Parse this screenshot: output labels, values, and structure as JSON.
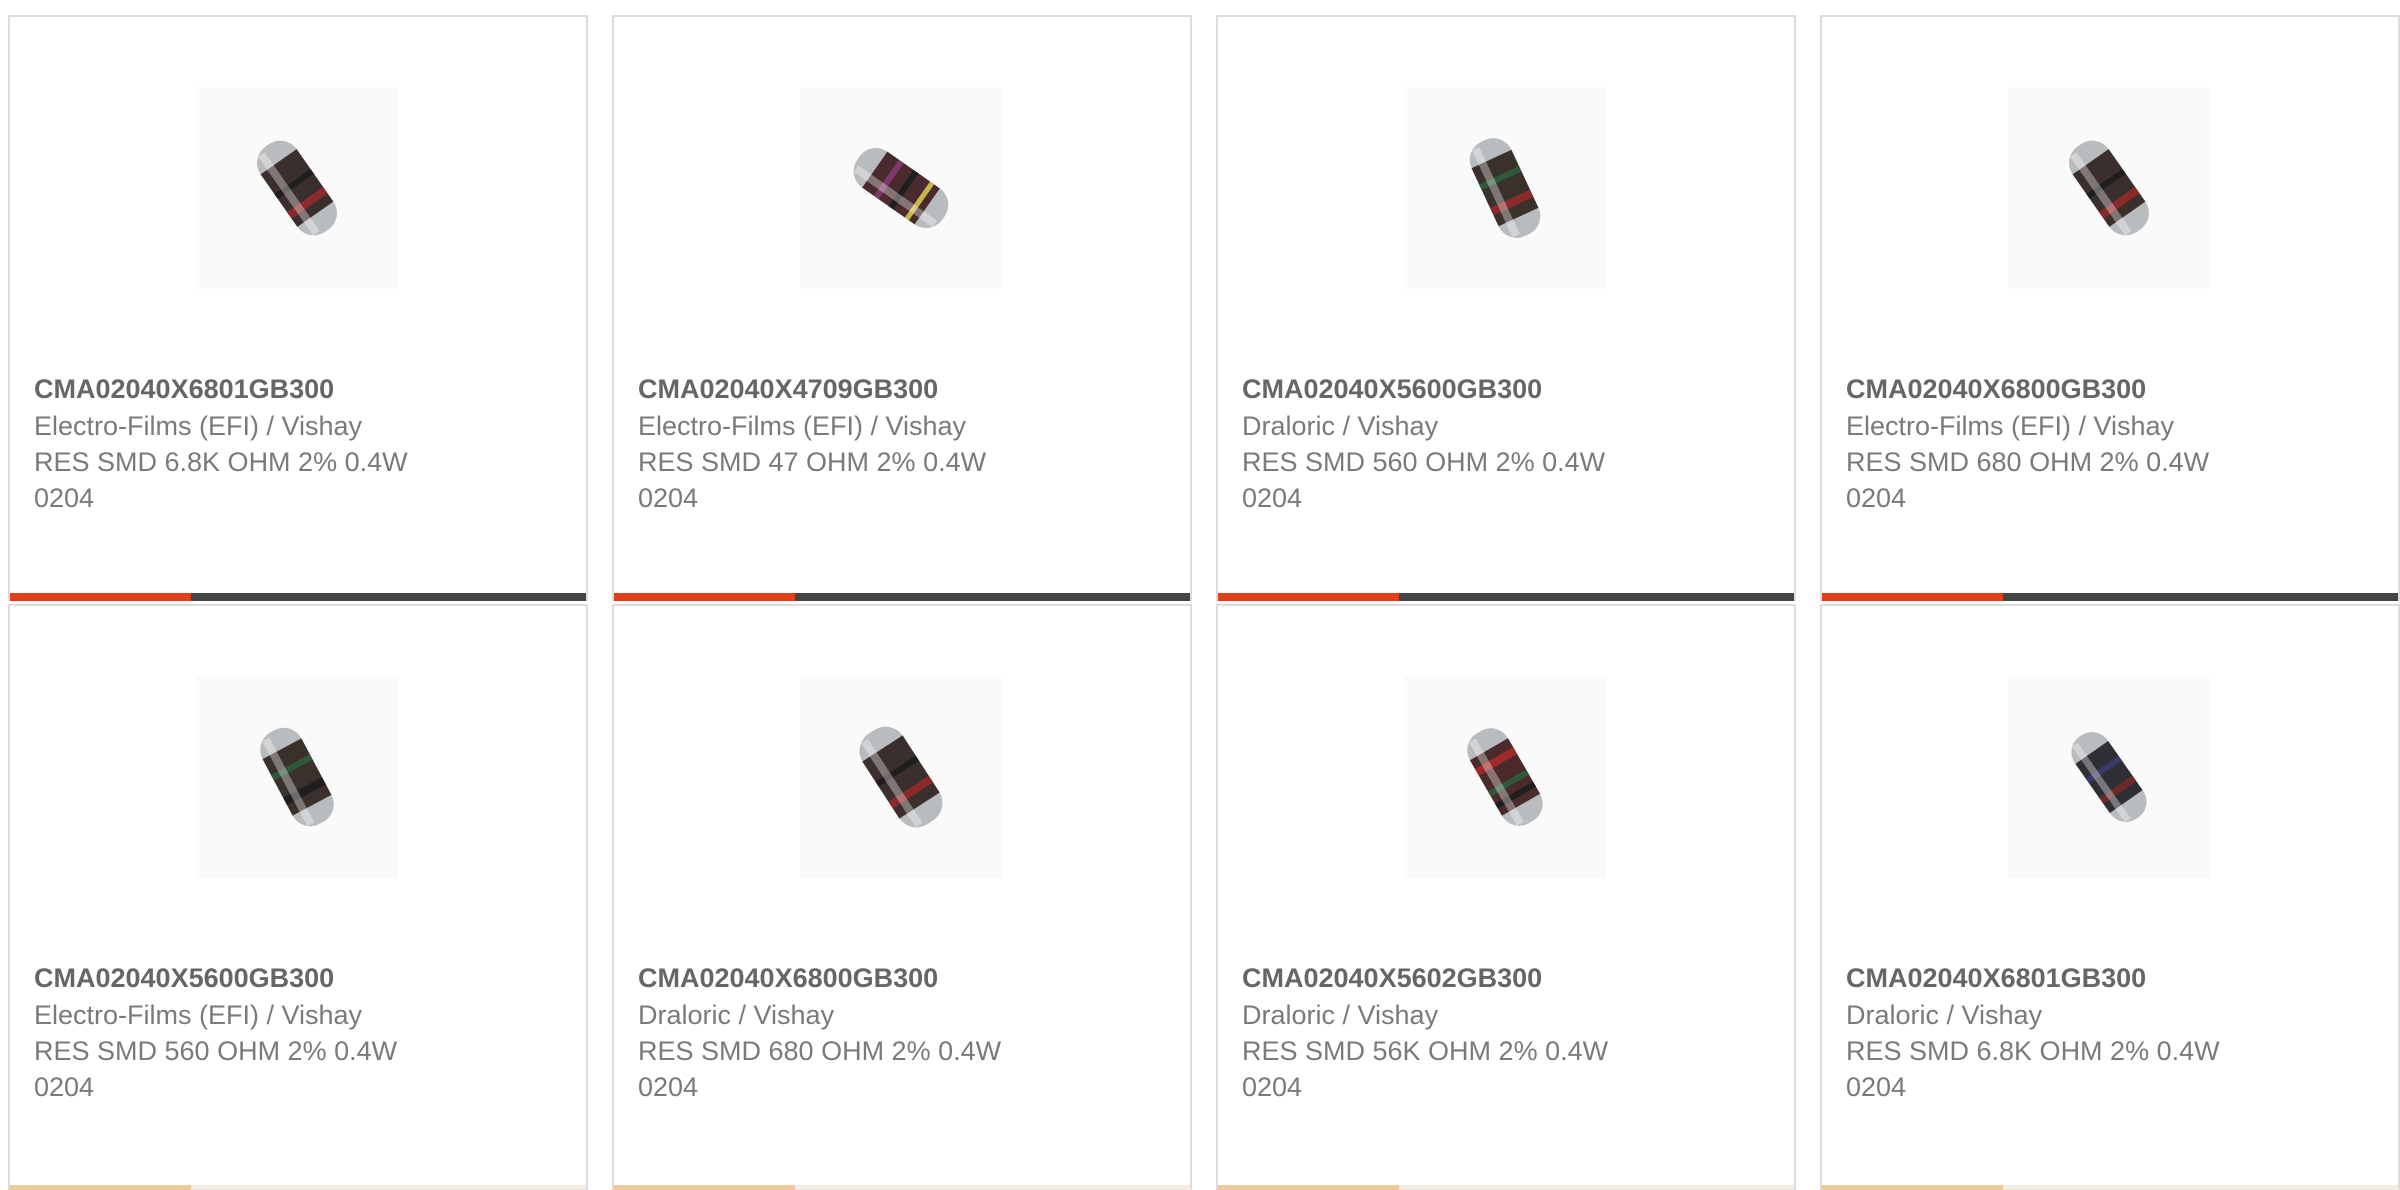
{
  "accent_color": "#e0401a",
  "bar_color": "#444444",
  "products": [
    {
      "part_number": "CMA02040X6801GB300",
      "manufacturer": "Electro-Films (EFI) / Vishay",
      "description_line1": "RES SMD 6.8K OHM 2% 0.4W",
      "description_line2": "0204",
      "image_icon": "resistor-image"
    },
    {
      "part_number": "CMA02040X4709GB300",
      "manufacturer": "Electro-Films (EFI) / Vishay",
      "description_line1": "RES SMD 47 OHM 2% 0.4W",
      "description_line2": "0204",
      "image_icon": "resistor-image"
    },
    {
      "part_number": "CMA02040X5600GB300",
      "manufacturer": "Draloric / Vishay",
      "description_line1": "RES SMD 560 OHM 2% 0.4W",
      "description_line2": "0204",
      "image_icon": "resistor-image"
    },
    {
      "part_number": "CMA02040X6800GB300",
      "manufacturer": "Electro-Films (EFI) / Vishay",
      "description_line1": "RES SMD 680 OHM 2% 0.4W",
      "description_line2": "0204",
      "image_icon": "resistor-image"
    },
    {
      "part_number": "CMA02040X5600GB300",
      "manufacturer": "Electro-Films (EFI) / Vishay",
      "description_line1": "RES SMD 560 OHM 2% 0.4W",
      "description_line2": "0204",
      "image_icon": "resistor-image"
    },
    {
      "part_number": "CMA02040X6800GB300",
      "manufacturer": "Draloric / Vishay",
      "description_line1": "RES SMD 680 OHM 2% 0.4W",
      "description_line2": "0204",
      "image_icon": "resistor-image"
    },
    {
      "part_number": "CMA02040X5602GB300",
      "manufacturer": "Draloric / Vishay",
      "description_line1": "RES SMD 56K OHM 2% 0.4W",
      "description_line2": "0204",
      "image_icon": "resistor-image"
    },
    {
      "part_number": "CMA02040X6801GB300",
      "manufacturer": "Draloric / Vishay",
      "description_line1": "RES SMD 6.8K OHM 2% 0.4W",
      "description_line2": "0204",
      "image_icon": "resistor-image"
    }
  ]
}
